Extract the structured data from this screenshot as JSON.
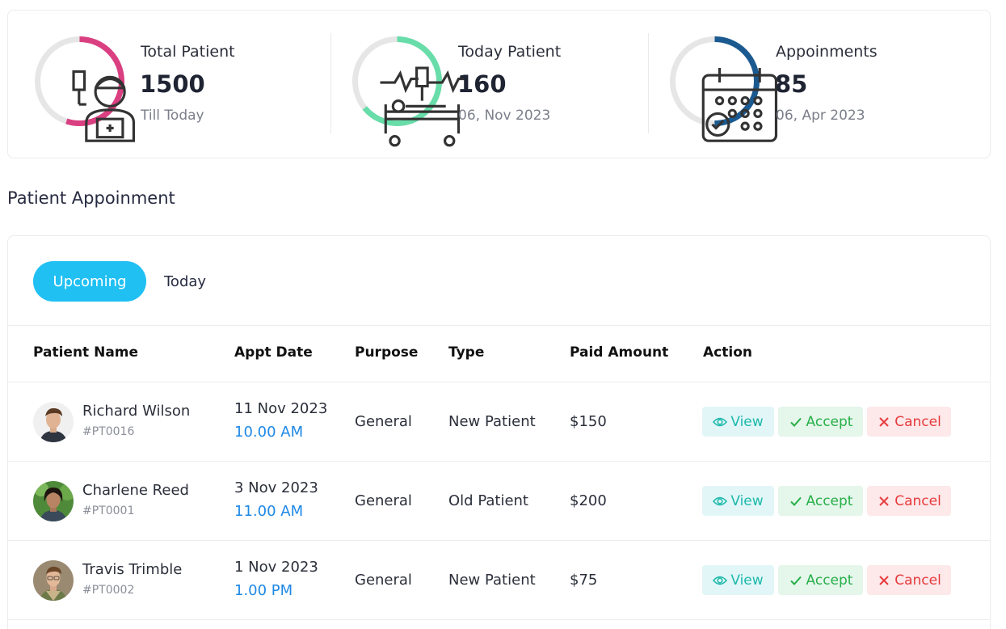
{
  "stats": [
    {
      "label": "Total Patient",
      "value": "1500",
      "sub": "Till Today",
      "color": "#da3f81",
      "progress": 0.55,
      "icon": "patient-icon"
    },
    {
      "label": "Today Patient",
      "value": "160",
      "sub": "06, Nov 2023",
      "color": "#68dda9",
      "progress": 0.64,
      "icon": "hospital-bed-icon"
    },
    {
      "label": "Appoinments",
      "value": "85",
      "sub": "06, Apr 2023",
      "color": "#1b5a90",
      "progress": 0.5,
      "icon": "calendar-icon"
    }
  ],
  "section_title": "Patient Appoinment",
  "tabs": {
    "upcoming": "Upcoming",
    "today": "Today"
  },
  "table": {
    "headers": {
      "patient_name": "Patient Name",
      "appt_date": "Appt Date",
      "purpose": "Purpose",
      "type": "Type",
      "paid_amount": "Paid Amount",
      "action": "Action"
    },
    "rows": [
      {
        "name": "Richard Wilson",
        "id": "#PT0016",
        "date": "11 Nov 2023",
        "time": "10.00 AM",
        "purpose": "General",
        "type": "New Patient",
        "amount": "$150"
      },
      {
        "name": "Charlene Reed",
        "id": "#PT0001",
        "date": "3 Nov 2023",
        "time": "11.00 AM",
        "purpose": "General",
        "type": "Old Patient",
        "amount": "$200"
      },
      {
        "name": "Travis Trimble",
        "id": "#PT0002",
        "date": "1 Nov 2023",
        "time": "1.00 PM",
        "purpose": "General",
        "type": "New Patient",
        "amount": "$75"
      }
    ],
    "actions": {
      "view": "View",
      "accept": "Accept",
      "cancel": "Cancel"
    }
  },
  "colors": {
    "accent": "#20c0f3",
    "view": "#1db9aa",
    "accept": "#26af48",
    "cancel": "#e63c3c",
    "time": "#1e88e5"
  }
}
